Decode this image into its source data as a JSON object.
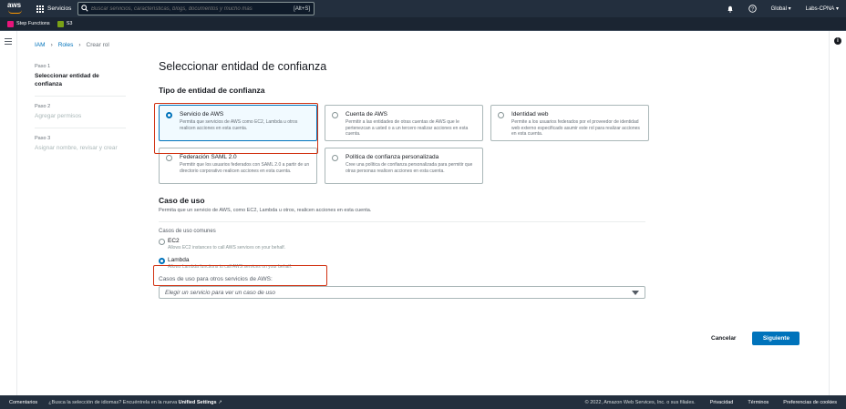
{
  "topbar": {
    "logo_text": "aws",
    "services_label": "Servicios",
    "search_placeholder": "Buscar servicios, características, blogs, documentos y mucho más",
    "search_shortcut": "[Alt+S]",
    "region_label": "Global",
    "account_label": "Labs-CPNA"
  },
  "favorites": [
    {
      "label": "Step Functions",
      "color": "#e7157b"
    },
    {
      "label": "S3",
      "color": "#7aa116"
    }
  ],
  "breadcrumb": {
    "items": [
      "IAM",
      "Roles",
      "Crear rol"
    ]
  },
  "steps": [
    {
      "num": "Paso 1",
      "label": "Seleccionar entidad de confianza",
      "active": true
    },
    {
      "num": "Paso 2",
      "label": "Agregar permisos",
      "active": false
    },
    {
      "num": "Paso 3",
      "label": "Asignar nombre, revisar y crear",
      "active": false
    }
  ],
  "main": {
    "title": "Seleccionar entidad de confianza",
    "entity_section_title": "Tipo de entidad de confianza",
    "tiles": [
      {
        "title": "Servicio de AWS",
        "desc": "Permita que servicios de AWS como EC2, Lambda u otros realicen acciones en esta cuenta.",
        "selected": true
      },
      {
        "title": "Cuenta de AWS",
        "desc": "Permitir a las entidades de otras cuentas de AWS que le pertenezcan a usted o a un tercero realizar acciones en esta cuenta.",
        "selected": false
      },
      {
        "title": "Identidad web",
        "desc": "Permite a los usuarios federados por el proveedor de identidad web externo especificado asumir este rol para realizar acciones en esta cuenta.",
        "selected": false
      },
      {
        "title": "Federación SAML 2.0",
        "desc": "Permitir que los usuarios federados con SAML 2.0 a partir de un directorio corporativo realicen acciones en esta cuenta.",
        "selected": false
      },
      {
        "title": "Política de confianza personalizada",
        "desc": "Cree una política de confianza personalizada para permitir que otras personas realicen acciones en esta cuenta.",
        "selected": false
      }
    ],
    "use_case": {
      "title": "Caso de uso",
      "desc": "Permita que un servicio de AWS, como EC2, Lambda u otros, realicen acciones en esta cuenta.",
      "common_label": "Casos de uso comunes",
      "options": [
        {
          "title": "EC2",
          "desc": "Allows EC2 instances to call AWS services on your behalf.",
          "selected": false
        },
        {
          "title": "Lambda",
          "desc": "Allows Lambda functions to call AWS services on your behalf.",
          "selected": true
        }
      ],
      "other_label": "Casos de uso para otros servicios de AWS:",
      "select_placeholder": "Elegir un servicio para ver un caso de uso"
    }
  },
  "actions": {
    "cancel": "Cancelar",
    "next": "Siguiente"
  },
  "footer": {
    "feedback": "Comentarios",
    "message_prefix": "¿Busca la selección de idiomas? Encuéntrela en la nueva",
    "message_link": "Unified Settings",
    "copyright": "© 2022, Amazon Web Services, Inc. o sus filiales.",
    "privacy": "Privacidad",
    "terms": "Términos",
    "cookies": "Preferencias de cookies"
  },
  "colors": {
    "highlight": "#d13212",
    "primary": "#0073bb",
    "nav_bg": "#232f3e"
  }
}
